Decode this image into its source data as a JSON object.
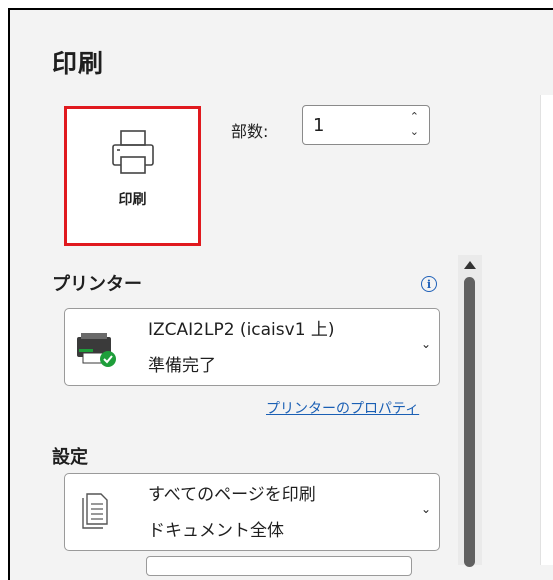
{
  "title": "印刷",
  "print_button": {
    "label": "印刷"
  },
  "copies": {
    "label": "部数:",
    "value": "1",
    "up": "⌃",
    "down": "⌄"
  },
  "printer": {
    "section_label": "プリンター",
    "info_icon": "i",
    "name": "IZCAI2LP2 (icaisv1 上)",
    "status": "準備完了",
    "properties_link": "プリンターのプロパティ",
    "chevron": "⌄"
  },
  "settings": {
    "section_label": "設定",
    "page_range_title": "すべてのページを印刷",
    "page_range_subtitle": "ドキュメント全体",
    "chevron": "⌄"
  },
  "colors": {
    "highlight": "#e0191e",
    "link": "#1a5fb4",
    "printer_green": "#1e9e3a"
  }
}
